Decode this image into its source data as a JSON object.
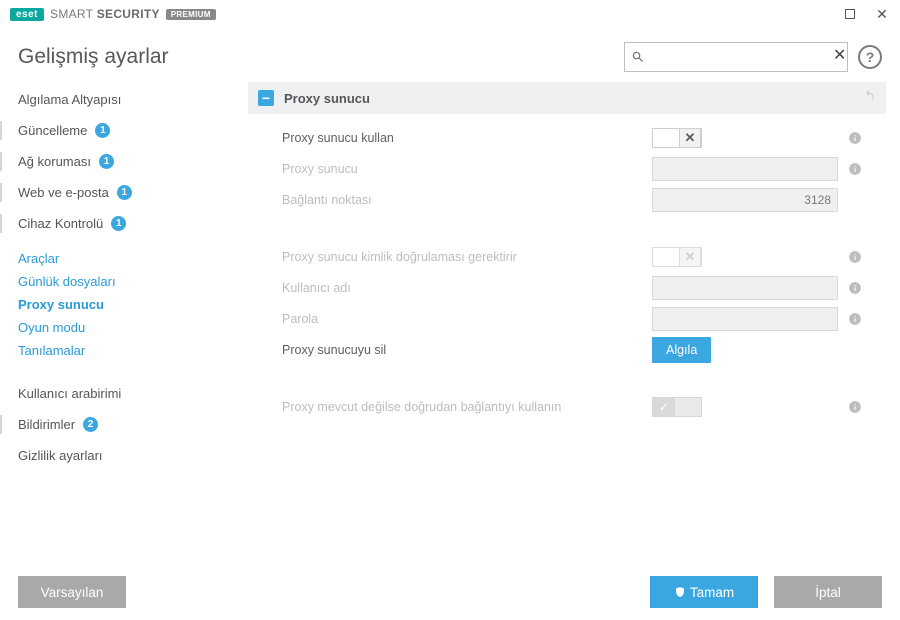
{
  "brand": {
    "eset": "eset",
    "product_prefix": "SMART ",
    "product_bold": "SECURITY",
    "premium": "PREMIUM"
  },
  "page_title": "Gelişmiş ayarlar",
  "search": {
    "value": "",
    "placeholder": ""
  },
  "sidebar": {
    "items": [
      {
        "label": "Algılama Altyapısı",
        "badge": null
      },
      {
        "label": "Güncelleme",
        "badge": "1"
      },
      {
        "label": "Ağ koruması",
        "badge": "1"
      },
      {
        "label": "Web ve e-posta",
        "badge": "1"
      },
      {
        "label": "Cihaz Kontrolü",
        "badge": "1"
      },
      {
        "label": "Araçlar",
        "badge": null
      },
      {
        "label": "Kullanıcı arabirimi",
        "badge": null
      },
      {
        "label": "Bildirimler",
        "badge": "2"
      },
      {
        "label": "Gizlilik ayarları",
        "badge": null
      }
    ],
    "subitems": [
      {
        "label": "Günlük dosyaları"
      },
      {
        "label": "Proxy sunucu"
      },
      {
        "label": "Oyun modu"
      },
      {
        "label": "Tanılamalar"
      }
    ]
  },
  "section": {
    "title": "Proxy sunucu"
  },
  "form": {
    "use_proxy_label": "Proxy sunucu kullan",
    "use_proxy_value": false,
    "server_label": "Proxy sunucu",
    "server_value": "",
    "port_label": "Bağlantı noktası",
    "port_value": "3128",
    "auth_label": "Proxy sunucu kimlik doğrulaması gerektirir",
    "auth_value": false,
    "user_label": "Kullanıcı adı",
    "user_value": "",
    "pass_label": "Parola",
    "pass_value": "",
    "detect_label": "Proxy sunucuyu sil",
    "detect_button": "Algıla",
    "direct_label": "Proxy mevcut değilse doğrudan bağlantıyı kullanın",
    "direct_value": true
  },
  "footer": {
    "default": "Varsayılan",
    "ok": "Tamam",
    "cancel": "İptal"
  }
}
